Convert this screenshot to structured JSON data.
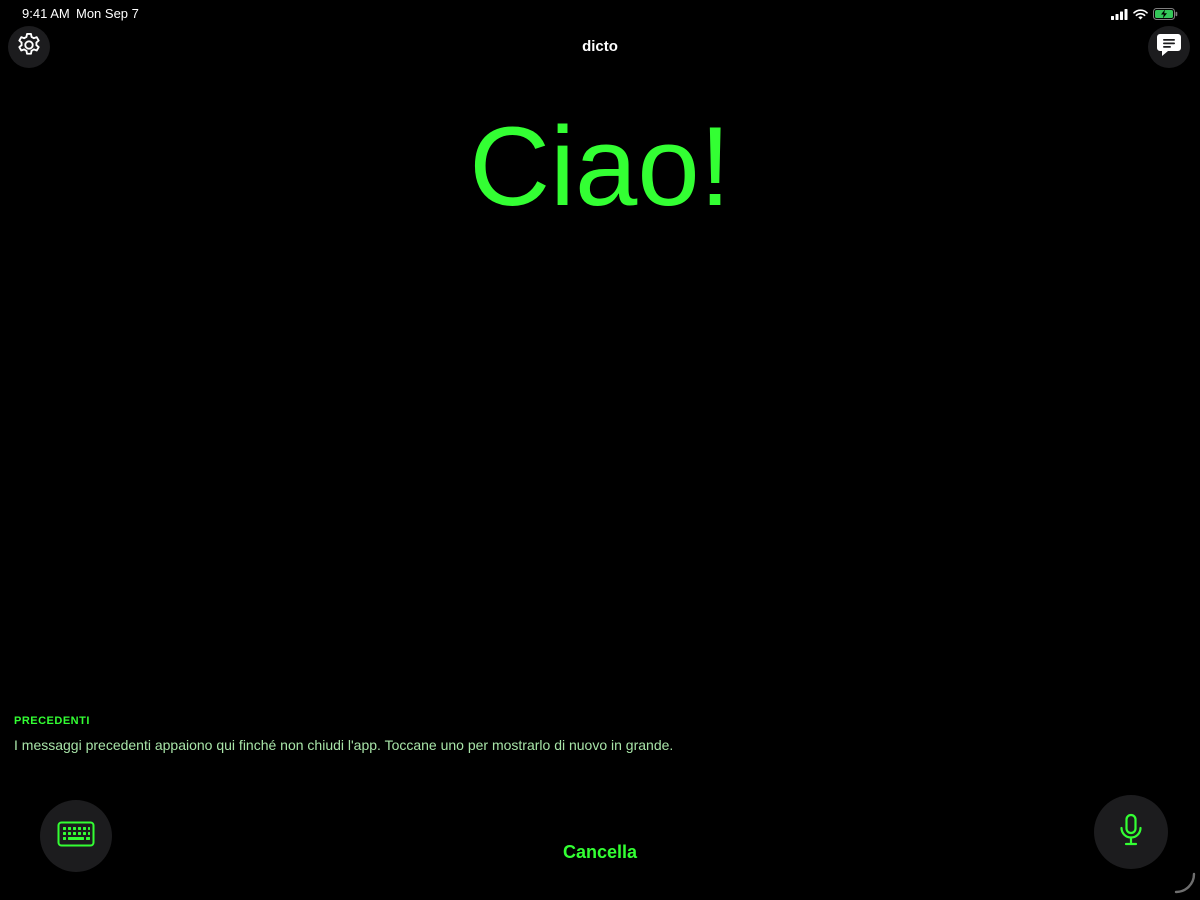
{
  "status_bar": {
    "time": "9:41 AM",
    "date": "Mon Sep 7",
    "icons": [
      "cellular-signal-icon",
      "wifi-icon",
      "battery-charging-icon"
    ]
  },
  "header": {
    "title": "dicto",
    "left_icon": "gear-icon",
    "right_icon": "message-bubble-icon"
  },
  "main": {
    "message": "Ciao!"
  },
  "previous": {
    "header": "PRECEDENTI",
    "hint": "I messaggi precedenti appaiono qui finché non chiudi l'app. Toccane uno per mostrarlo di nuovo in grande."
  },
  "footer": {
    "cancel_label": "Cancella",
    "left_icon": "keyboard-icon",
    "right_icon": "microphone-icon"
  },
  "colors": {
    "accent": "#33ff33",
    "background": "#000000",
    "button_bg": "#1c1c1e",
    "hint_text": "#a8e4a8"
  }
}
